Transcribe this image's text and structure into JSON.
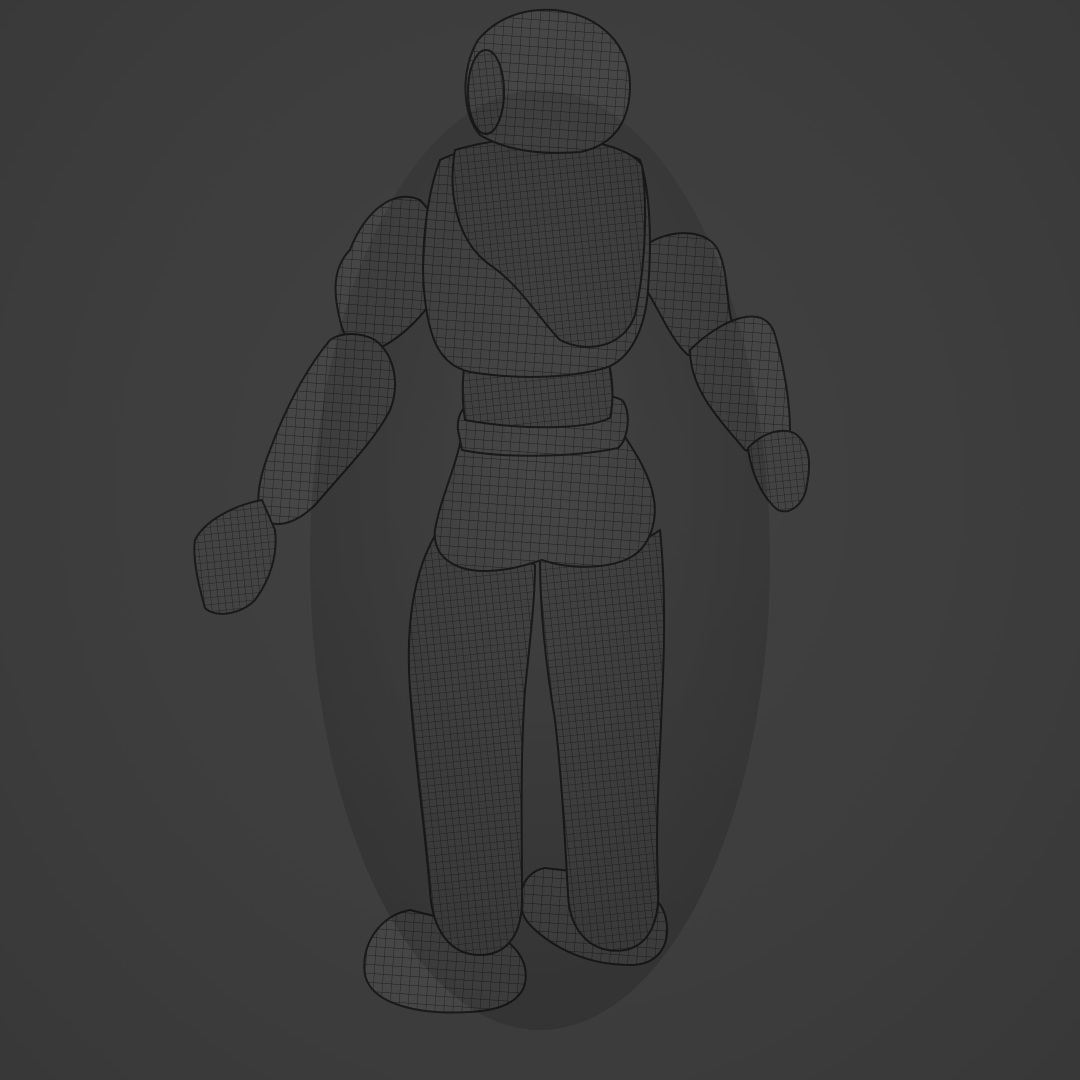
{
  "viewport": {
    "background_color": "#3d3d3d",
    "object": {
      "type": "character-mesh",
      "display_mode": "wireframe-over-solid",
      "surface_color": "#454545",
      "wire_color": "#1e1e1e"
    }
  }
}
